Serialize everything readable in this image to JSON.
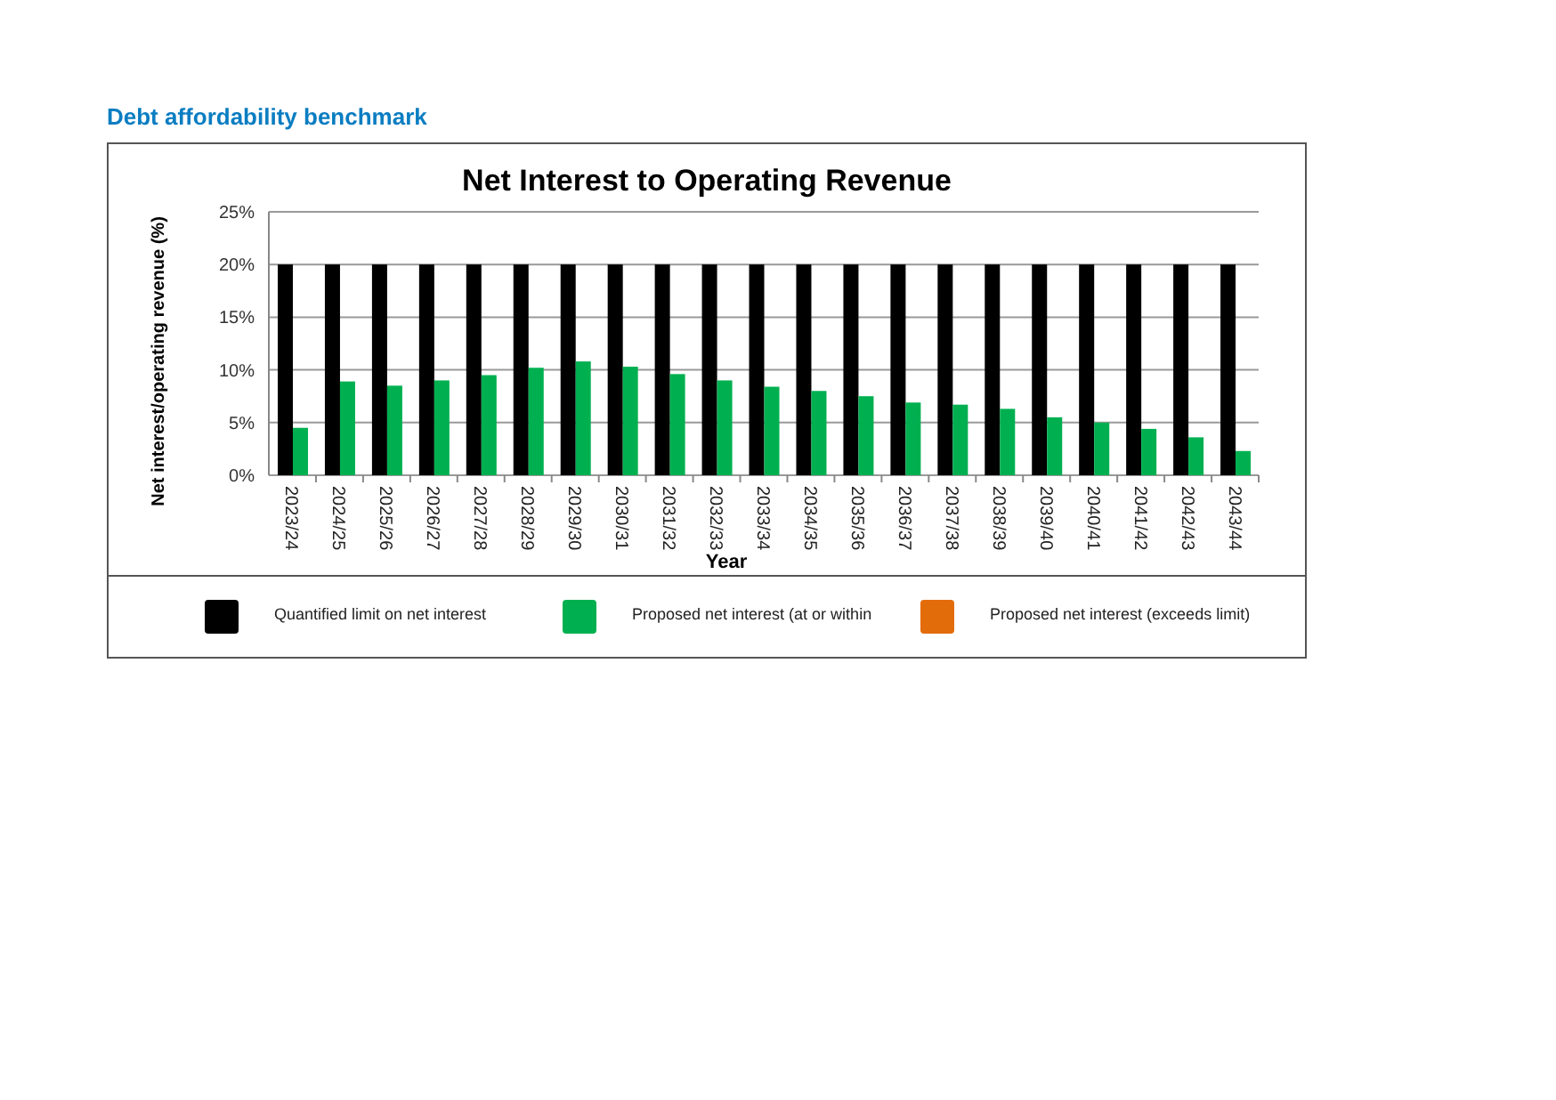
{
  "section_heading": "Debt affordability benchmark",
  "chart": {
    "chart_data": {
      "type": "bar",
      "title": "Net Interest to Operating Revenue",
      "xlabel": "Year",
      "ylabel": "Net interest/operating revenue (%)",
      "categories": [
        "2023/24",
        "2024/25",
        "2025/26",
        "2026/27",
        "2027/28",
        "2028/29",
        "2029/30",
        "2030/31",
        "2031/32",
        "2032/33",
        "2033/34",
        "2034/35",
        "2035/36",
        "2036/37",
        "2037/38",
        "2038/39",
        "2039/40",
        "2040/41",
        "2041/42",
        "2042/43",
        "2043/44"
      ],
      "series": [
        {
          "name": "Quantified limit on net interest",
          "color": "#000000",
          "values": [
            20,
            20,
            20,
            20,
            20,
            20,
            20,
            20,
            20,
            20,
            20,
            20,
            20,
            20,
            20,
            20,
            20,
            20,
            20,
            20,
            20
          ]
        },
        {
          "name": "Proposed net interest (at or within",
          "color": "#00b050",
          "values": [
            4.5,
            8.9,
            8.5,
            9.0,
            9.5,
            10.2,
            10.8,
            10.3,
            9.6,
            9.0,
            8.4,
            8.0,
            7.5,
            6.9,
            6.7,
            6.3,
            5.5,
            5.0,
            4.4,
            3.6,
            2.3
          ]
        },
        {
          "name": "Proposed net interest (exceeds limit)",
          "color": "#e36c0a",
          "values": [
            null,
            null,
            null,
            null,
            null,
            null,
            null,
            null,
            null,
            null,
            null,
            null,
            null,
            null,
            null,
            null,
            null,
            null,
            null,
            null,
            null
          ]
        }
      ],
      "ylim": [
        0,
        25
      ],
      "grid": true,
      "yticks": [
        {
          "value": 0,
          "label": "0%"
        },
        {
          "value": 5,
          "label": "5%"
        },
        {
          "value": 10,
          "label": "10%"
        },
        {
          "value": 15,
          "label": "15%"
        },
        {
          "value": 20,
          "label": "20%"
        },
        {
          "value": 25,
          "label": "25%"
        }
      ]
    }
  }
}
